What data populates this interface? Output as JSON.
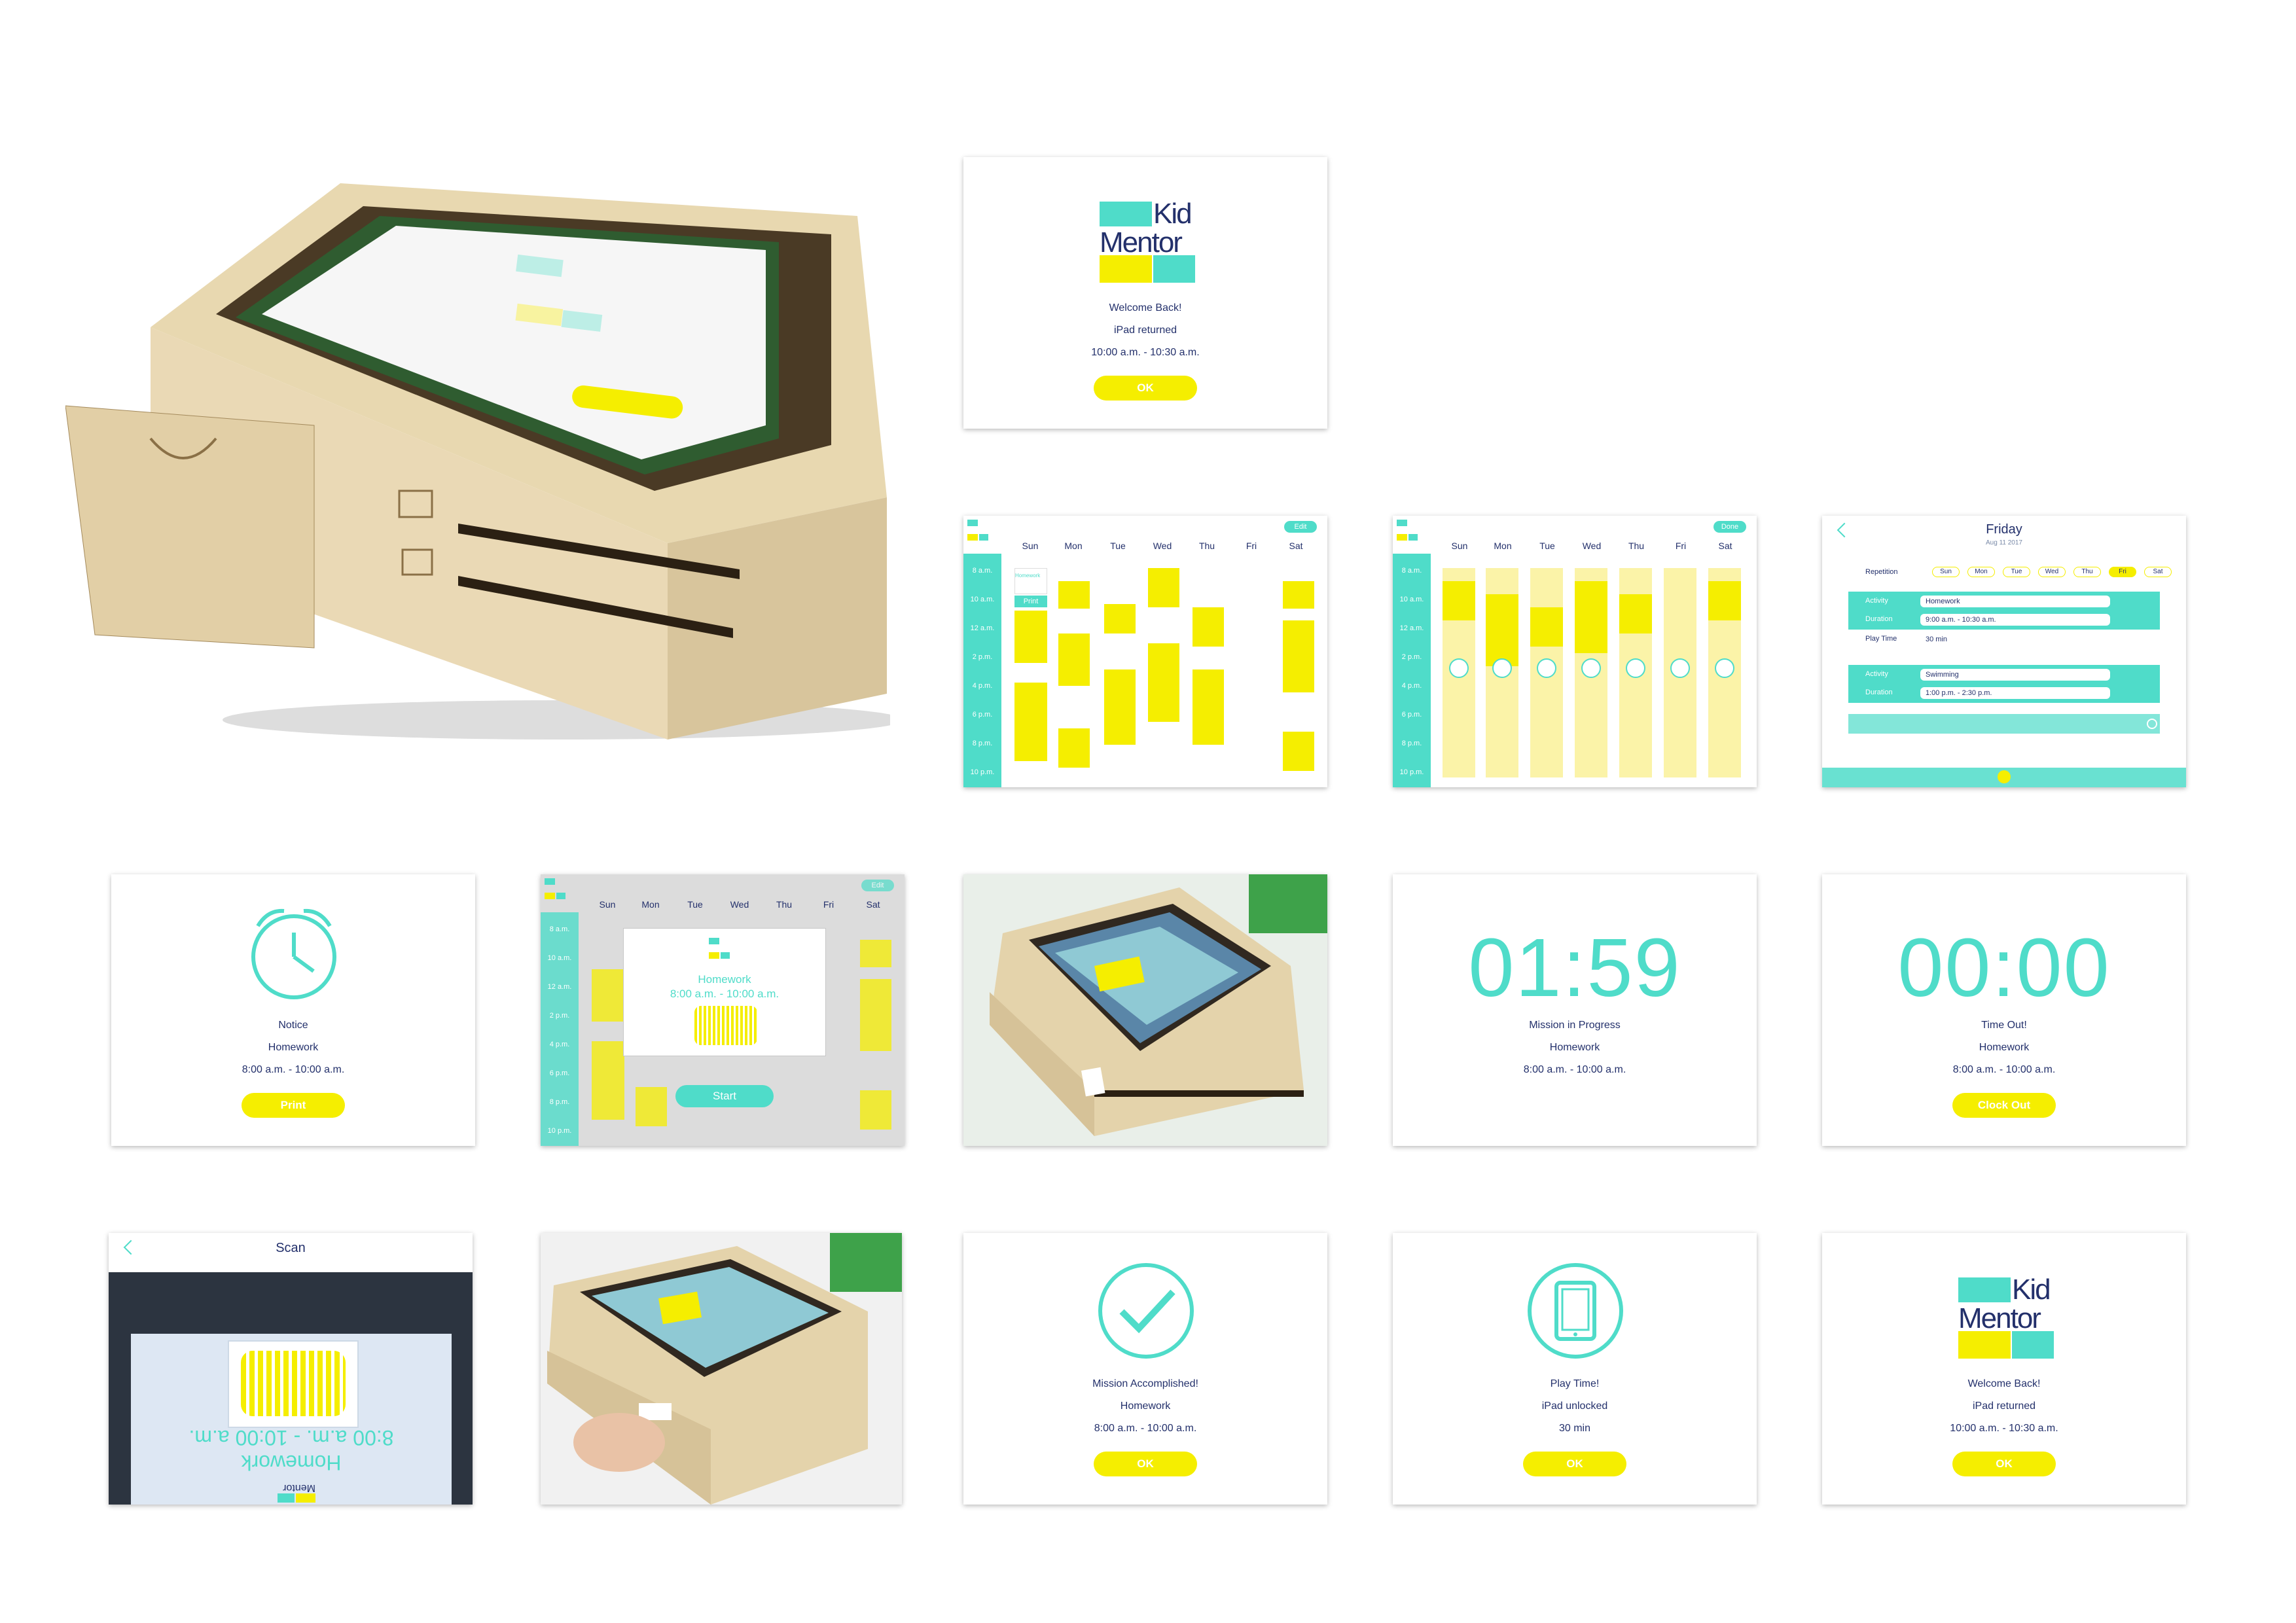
{
  "logo": {
    "kid": "Kid",
    "mentor": "Mentor"
  },
  "welcome": {
    "title": "Welcome Back!",
    "line2": "iPad returned",
    "time": "10:00 a.m. - 10:30 a.m.",
    "ok": "OK"
  },
  "photo_ipad": {
    "title": "Welcome Back!",
    "line2": "iPad returned",
    "time": "10:00 a.m. - 10:30 a.m.",
    "ok": "OK"
  },
  "calendar": {
    "days": [
      "Sun",
      "Mon",
      "Tue",
      "Wed",
      "Thu",
      "Fri",
      "Sat"
    ],
    "times": [
      "8 a.m.",
      "10 a.m.",
      "12 a.m.",
      "2 p.m.",
      "4 p.m.",
      "6 p.m.",
      "8 p.m.",
      "10 p.m."
    ],
    "edit": "Edit",
    "done": "Done",
    "homework": "Homework",
    "print": "Print",
    "homework_calendar_times": [
      "8 a.m.",
      "10 a.m.",
      "12 a.m.",
      "2 p.m.",
      "4 p.m.",
      "6 p.m.",
      "8 p.m.",
      "10 p.m."
    ]
  },
  "detail": {
    "title": "Friday",
    "date": "Aug 11 2017",
    "repetition_label": "Repetition",
    "days": [
      "Sun",
      "Mon",
      "Tue",
      "Wed",
      "Thu",
      "Fri",
      "Sat"
    ],
    "activity_label": "Activity",
    "duration_label": "Duration",
    "playtime_label": "Play Time",
    "activity1": "Homework",
    "duration1": "9:00 a.m. - 10:30 a.m.",
    "playtime1": "30 min",
    "activity2": "Swimming",
    "duration2": "1:00 p.m. - 2:30 p.m."
  },
  "notice": {
    "title": "Notice",
    "activity": "Homework",
    "time": "8:00 a.m. - 10:00 a.m.",
    "button": "Print"
  },
  "popup": {
    "activity": "Homework",
    "time": "8:00 a.m. - 10:00 a.m.",
    "start": "Start"
  },
  "progress": {
    "timer": "01:59",
    "title": "Mission in Progress",
    "activity": "Homework",
    "time": "8:00 a.m. - 10:00 a.m."
  },
  "timeout": {
    "timer": "00:00",
    "title": "Time Out!",
    "activity": "Homework",
    "time": "8:00 a.m. - 10:00 a.m.",
    "button": "Clock Out"
  },
  "scan": {
    "title": "Scan",
    "ticket_activity": "Homework",
    "ticket_time": "8:00 a.m. - 10:00 a.m.",
    "ticket_logo": "Mentor"
  },
  "accomplished": {
    "title": "Mission Accomplished!",
    "activity": "Homework",
    "time": "8:00 a.m. - 10:00 a.m.",
    "ok": "OK"
  },
  "playtime": {
    "title": "Play Time!",
    "line2": "iPad unlocked",
    "duration": "30 min",
    "ok": "OK"
  },
  "welcome2": {
    "title": "Welcome Back!",
    "line2": "iPad returned",
    "time": "10:00 a.m. - 10:30 a.m.",
    "ok": "OK"
  },
  "colors": {
    "teal": "#4fdcc9",
    "yellow": "#f5ee00",
    "navy": "#23306b",
    "wood": "#e6d5ad"
  }
}
